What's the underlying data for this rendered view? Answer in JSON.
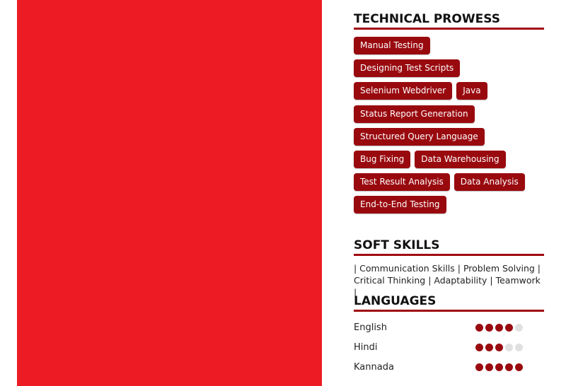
{
  "colors": {
    "panel": "#ed1c24",
    "accent": "#990a0f",
    "dot_empty": "#e0e0e0"
  },
  "technical": {
    "title": "TECHNICAL PROWESS",
    "rows": [
      [
        "Manual Testing"
      ],
      [
        "Designing Test Scripts"
      ],
      [
        "Selenium Webdriver",
        "Java"
      ],
      [
        "Status Report Generation"
      ],
      [
        "Structured Query Language"
      ],
      [
        "Bug Fixing",
        "Data Warehousing"
      ],
      [
        "Test Result Analysis",
        "Data Analysis"
      ],
      [
        "End-to-End Testing"
      ]
    ]
  },
  "soft": {
    "title": "SOFT SKILLS",
    "line1": "| Communication Skills | Problem Solving |",
    "line2": "Critical Thinking | Adaptability | Teamwork |"
  },
  "languages": {
    "title": "LANGUAGES",
    "items": [
      {
        "name": "English",
        "level": 4,
        "max": 5
      },
      {
        "name": "Hindi",
        "level": 3,
        "max": 5
      },
      {
        "name": "Kannada",
        "level": 5,
        "max": 5
      }
    ]
  }
}
